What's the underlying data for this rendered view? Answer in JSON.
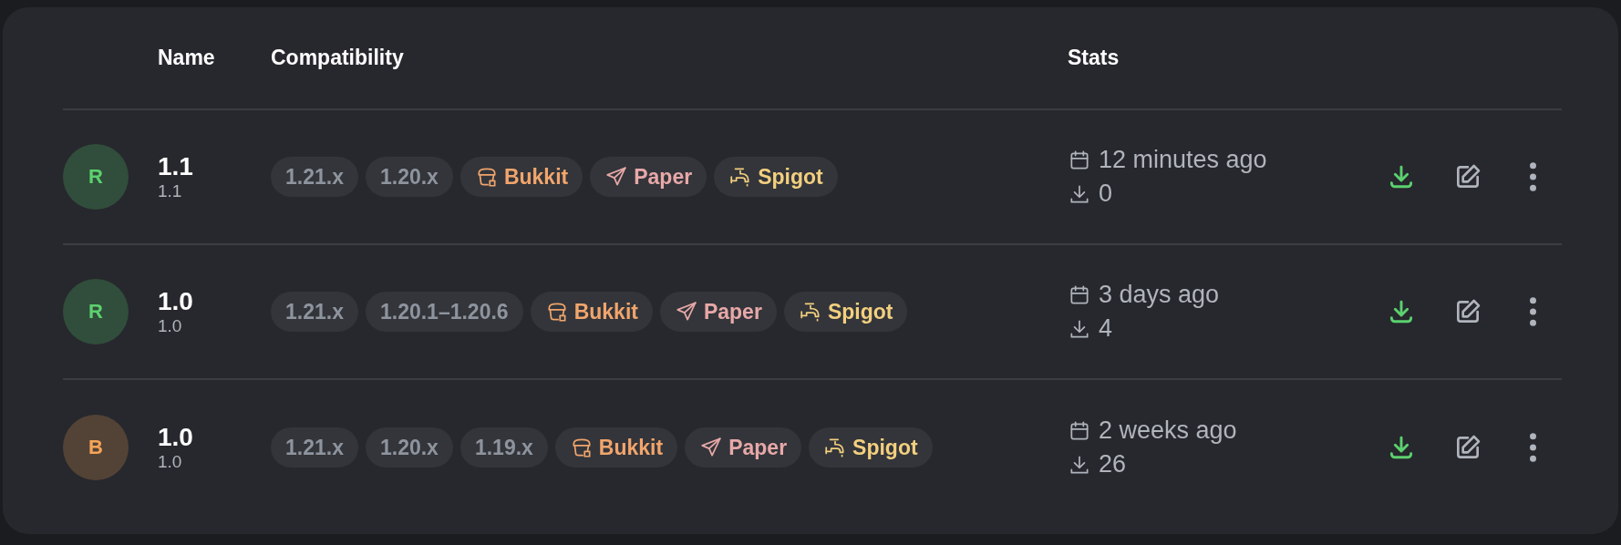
{
  "table": {
    "columns": [
      {
        "label": "Name"
      },
      {
        "label": "Compatibility"
      },
      {
        "label": "Stats"
      }
    ],
    "rows": [
      {
        "avatar": {
          "letter": "R",
          "color": "#5cd16f"
        },
        "name": "1.1",
        "subtitle": "1.1",
        "tags": [
          {
            "kind": "version",
            "label": "1.21.x"
          },
          {
            "kind": "version",
            "label": "1.20.x"
          },
          {
            "kind": "bukkit",
            "label": "Bukkit",
            "color": "#f1a56c"
          },
          {
            "kind": "paper",
            "label": "Paper",
            "color": "#e8a8a8"
          },
          {
            "kind": "spigot",
            "label": "Spigot",
            "color": "#f3cf7f"
          }
        ],
        "published": "12 minutes ago",
        "downloads": "0"
      },
      {
        "avatar": {
          "letter": "R",
          "color": "#5cd16f"
        },
        "name": "1.0",
        "subtitle": "1.0",
        "tags": [
          {
            "kind": "version",
            "label": "1.21.x"
          },
          {
            "kind": "version",
            "label": "1.20.1–1.20.6"
          },
          {
            "kind": "bukkit",
            "label": "Bukkit",
            "color": "#f1a56c"
          },
          {
            "kind": "paper",
            "label": "Paper",
            "color": "#e8a8a8"
          },
          {
            "kind": "spigot",
            "label": "Spigot",
            "color": "#f3cf7f"
          }
        ],
        "published": "3 days ago",
        "downloads": "4"
      },
      {
        "avatar": {
          "letter": "B",
          "color": "#f5a458"
        },
        "name": "1.0",
        "subtitle": "1.0",
        "tags": [
          {
            "kind": "version",
            "label": "1.21.x"
          },
          {
            "kind": "version",
            "label": "1.20.x"
          },
          {
            "kind": "version",
            "label": "1.19.x"
          },
          {
            "kind": "bukkit",
            "label": "Bukkit",
            "color": "#f1a56c"
          },
          {
            "kind": "paper",
            "label": "Paper",
            "color": "#e8a8a8"
          },
          {
            "kind": "spigot",
            "label": "Spigot",
            "color": "#f3cf7f"
          }
        ],
        "published": "2 weeks ago",
        "downloads": "26"
      }
    ]
  }
}
